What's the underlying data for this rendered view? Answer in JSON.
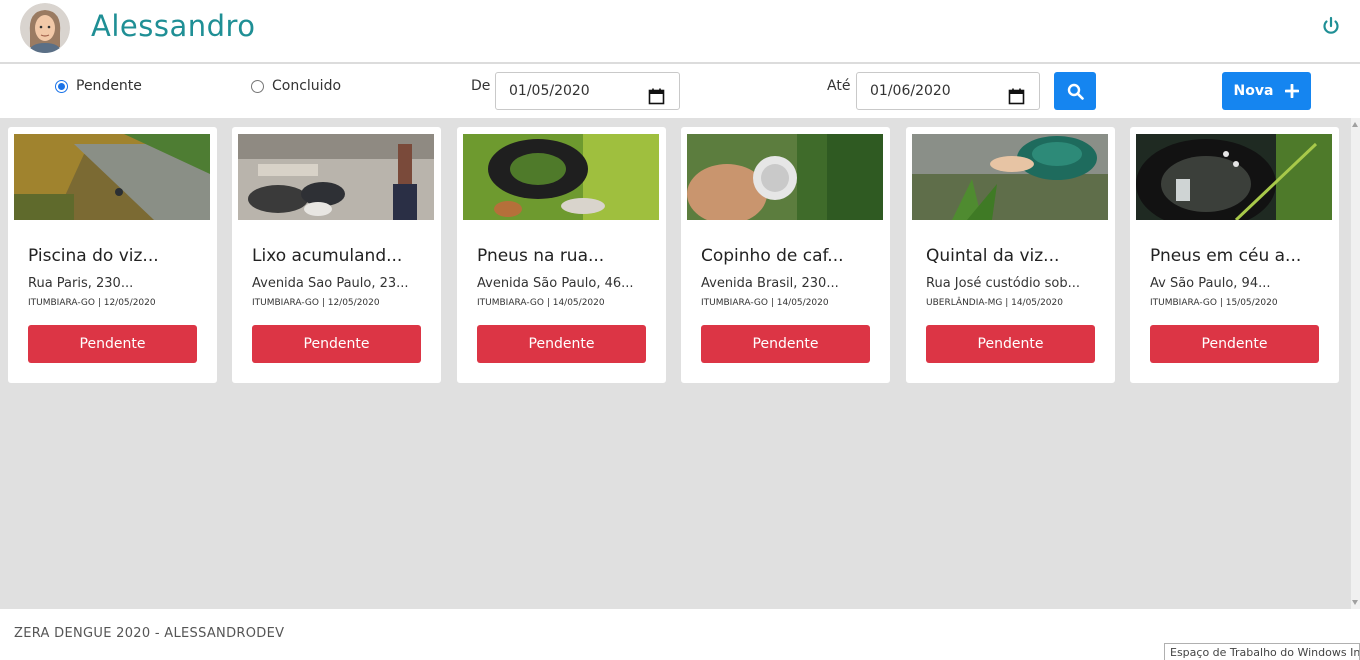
{
  "header": {
    "username": "Alessandro",
    "avatar_icon": "user-avatar",
    "power_icon": "power-icon",
    "accent_color": "#1f8f95"
  },
  "filters": {
    "status_options": [
      {
        "label": "Pendente",
        "checked": true
      },
      {
        "label": "Concluido",
        "checked": false
      }
    ],
    "from_label": "De",
    "from_value": "01/05/2020",
    "to_label": "Até",
    "to_value": "01/06/2020",
    "search_icon": "search-icon",
    "new_label": "Nova",
    "primary_color": "#1585f0"
  },
  "cards": [
    {
      "title": "Piscina do viz...",
      "address": "Rua Paris, 230...",
      "meta": "ITUMBIARA-GO | 12/05/2020",
      "status": "Pendente"
    },
    {
      "title": "Lixo acumuland...",
      "address": "Avenida Sao Paulo, 23...",
      "meta": "ITUMBIARA-GO | 12/05/2020",
      "status": "Pendente"
    },
    {
      "title": "Pneus na rua...",
      "address": "Avenida São Paulo, 46...",
      "meta": "ITUMBIARA-GO | 14/05/2020",
      "status": "Pendente"
    },
    {
      "title": "Copinho de caf...",
      "address": "Avenida Brasil, 230...",
      "meta": "ITUMBIARA-GO | 14/05/2020",
      "status": "Pendente"
    },
    {
      "title": "Quintal da viz...",
      "address": "Rua José custódio sob...",
      "meta": "UBERLÂNDIA-MG | 14/05/2020",
      "status": "Pendente"
    },
    {
      "title": "Pneus em céu a...",
      "address": "Av São Paulo, 94...",
      "meta": "ITUMBIARA-GO | 15/05/2020",
      "status": "Pendente"
    }
  ],
  "status_color": "#dc3545",
  "footer": {
    "text": "ZERA DENGUE 2020 - ALESSANDRODEV",
    "system_badge": "Espaço de Trabalho do Windows Ink"
  }
}
